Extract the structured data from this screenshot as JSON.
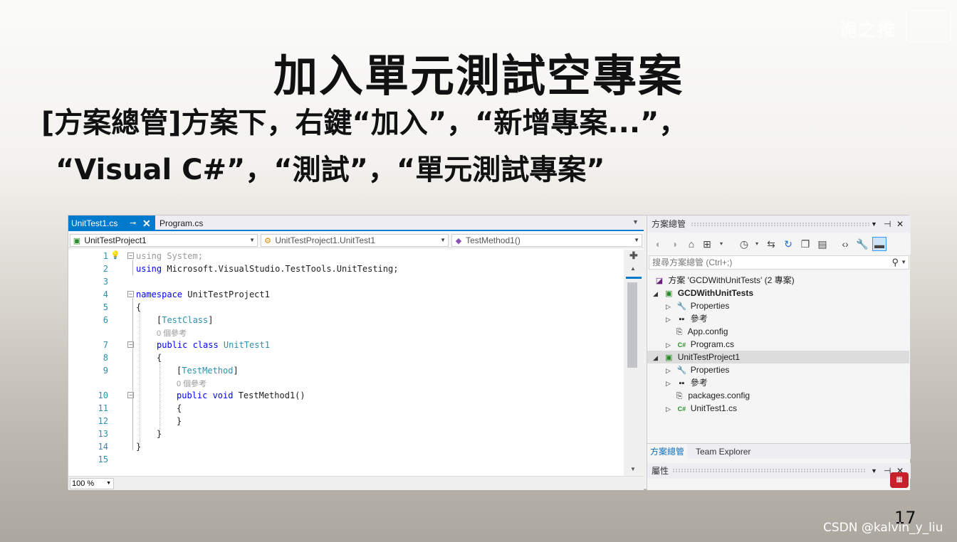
{
  "watermark": {
    "top_text": "诡之推"
  },
  "slide": {
    "title": "加入單元測試空專案",
    "line1": "[方案總管]方案下，右鍵“加入”，“新增專案...”，",
    "line2": "“Visual C#”，“測試”，“單元測試專案”",
    "page_number": "17",
    "credit": "CSDN @kalvin_y_liu"
  },
  "editor": {
    "tabs": [
      {
        "label": "UnitTest1.cs",
        "active": true
      },
      {
        "label": "Program.cs",
        "active": false
      }
    ],
    "nav": {
      "project": "UnitTestProject1",
      "class": "UnitTestProject1.UnitTest1",
      "member": "TestMethod1()"
    },
    "code": {
      "l1_kw": "using",
      "l1_rest": " System;",
      "l2_kw": "using",
      "l2_rest": " Microsoft.VisualStudio.TestTools.UnitTesting;",
      "l4_kw": "namespace",
      "l4_rest": " UnitTestProject1",
      "l5": "{",
      "l6_open": "[",
      "l6_attr": "TestClass",
      "l6_close": "]",
      "ref1": "0 個參考",
      "l7_kw": "public class",
      "l7_type": " UnitTest1",
      "l8": "{",
      "l9_open": "[",
      "l9_attr": "TestMethod",
      "l9_close": "]",
      "ref2": "0 個參考",
      "l10_kw": "public void",
      "l10_rest": " TestMethod1()",
      "l11": "{",
      "l12": "}",
      "l13": "}",
      "l14": "}"
    },
    "line_numbers": [
      "1",
      "2",
      "3",
      "4",
      "5",
      "6",
      "7",
      "8",
      "9",
      "10",
      "11",
      "12",
      "13",
      "14",
      "15"
    ],
    "zoom": "100 %"
  },
  "solution_explorer": {
    "title": "方案總管",
    "search_placeholder": "搜尋方案總管 (Ctrl+;)",
    "tree": {
      "solution": "方案 'GCDWithUnitTests' (2 專案)",
      "p1": "GCDWithUnitTests",
      "p1_props": "Properties",
      "p1_refs": "參考",
      "p1_app": "App.config",
      "p1_prog": "Program.cs",
      "p2": "UnitTestProject1",
      "p2_props": "Properties",
      "p2_refs": "參考",
      "p2_pkg": "packages.config",
      "p2_ut": "UnitTest1.cs"
    },
    "bottom_tabs": [
      "方案總管",
      "Team Explorer"
    ],
    "properties_title": "屬性"
  },
  "colors": {
    "accent": "#007acc",
    "keyword": "#0000ff",
    "type": "#2b91af"
  },
  "icons": [
    "pin-icon",
    "close-icon",
    "back-icon",
    "forward-icon",
    "home-icon",
    "switch-views-icon",
    "pending-changes-icon",
    "sync-icon",
    "refresh-icon",
    "collapse-all-icon",
    "show-all-files-icon",
    "view-code-icon",
    "properties-icon",
    "preview-icon",
    "search-icon",
    "lightbulb-icon"
  ]
}
